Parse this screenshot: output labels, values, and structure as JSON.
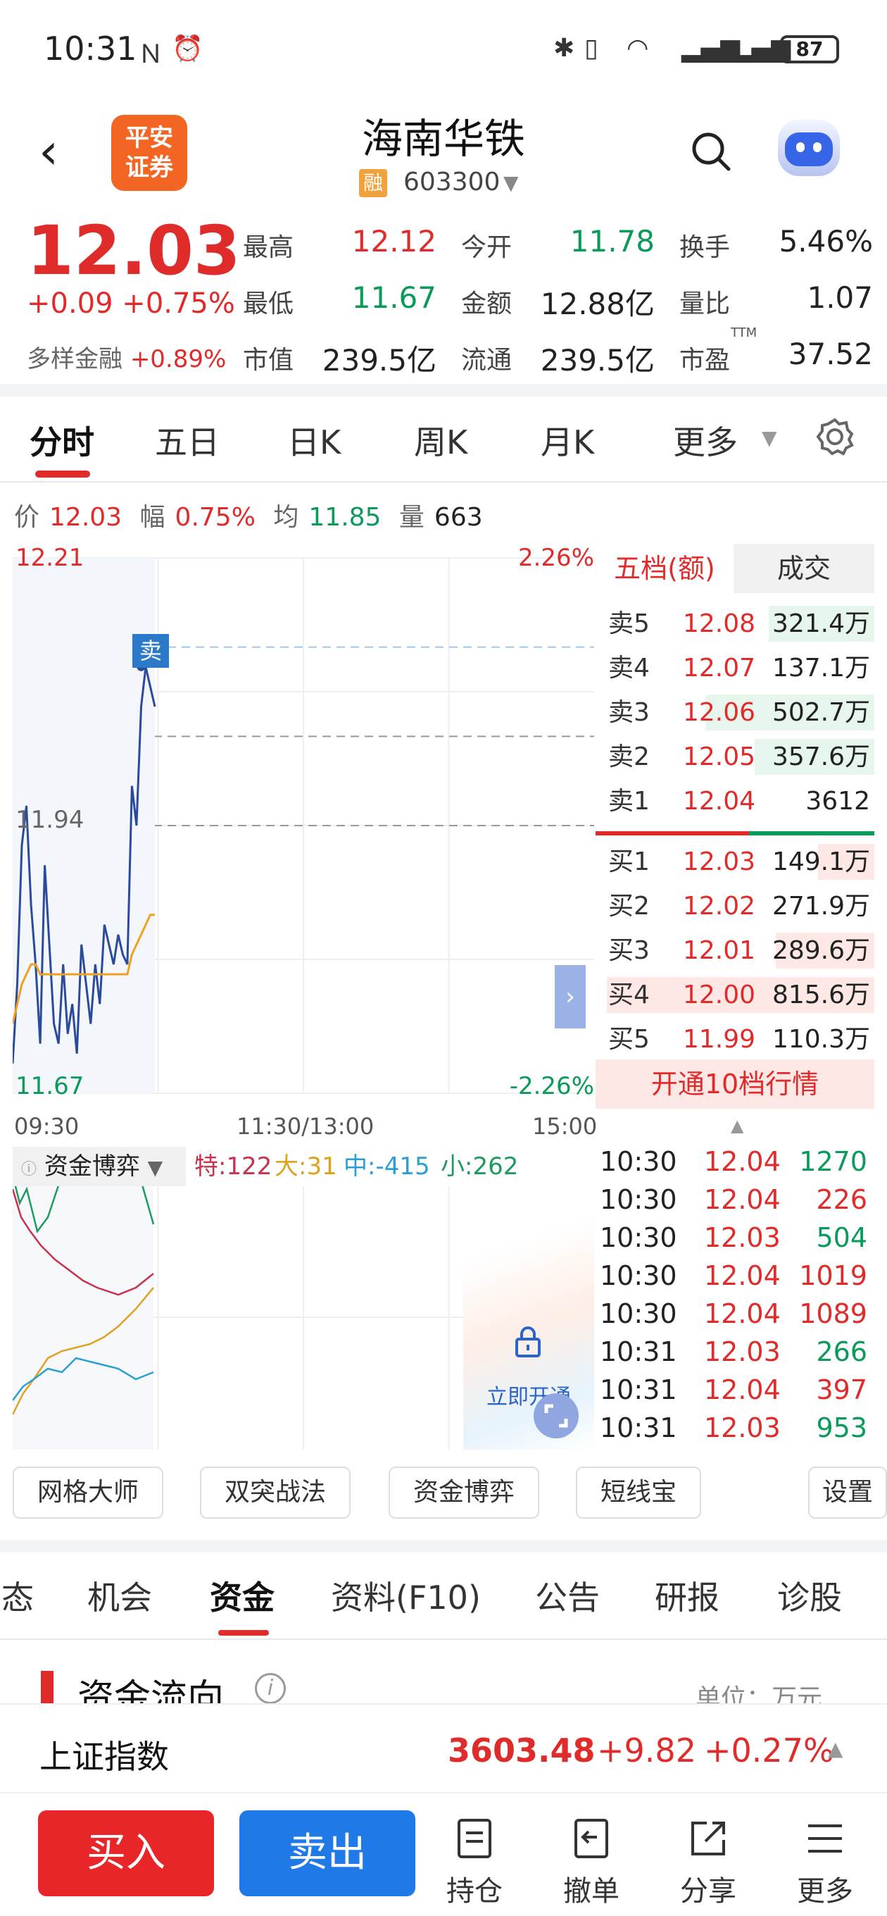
{
  "status_bar": {
    "time": "10:31",
    "battery": "87"
  },
  "header": {
    "logo_text_1": "平安",
    "logo_text_2": "证券",
    "stock_name": "海南华铁",
    "rong_tag": "融",
    "stock_code": "603300"
  },
  "quote": {
    "price": "12.03",
    "change": "+0.09",
    "change_pct": "+0.75%",
    "sector_label": "多样金融",
    "sector_pct": "+0.89%",
    "high_label": "最高",
    "high": "12.12",
    "open_label": "今开",
    "open": "11.78",
    "turnover_label": "换手",
    "turnover": "5.46%",
    "low_label": "最低",
    "low": "11.67",
    "amount_label": "金额",
    "amount": "12.88亿",
    "vol_ratio_label": "量比",
    "vol_ratio": "1.07",
    "mcap_label": "市值",
    "mcap": "239.5亿",
    "float_label": "流通",
    "float": "239.5亿",
    "pe_label": "市盈",
    "pe_sup": "TTM",
    "pe": "37.52"
  },
  "tabs": [
    "分时",
    "五日",
    "日K",
    "周K",
    "月K",
    "更多"
  ],
  "info_line": {
    "price_label": "价",
    "price": "12.03",
    "amp_label": "幅",
    "amp": "0.75%",
    "avg_label": "均",
    "avg": "11.85",
    "vol_label": "量",
    "vol": "663"
  },
  "chart_labels": {
    "top_price": "12.21",
    "top_pct": "2.26%",
    "mid_price": "11.94",
    "bottom_price": "11.67",
    "bottom_pct": "-2.26%",
    "sell_marker": "卖",
    "t_start": "09:30",
    "t_mid": "11:30/13:00",
    "t_end": "15:00"
  },
  "chart_data": {
    "type": "line",
    "x_range": [
      "09:30",
      "15:00"
    ],
    "ylim": [
      11.67,
      12.21
    ],
    "series": [
      {
        "values": [
          11.7,
          11.78,
          11.92,
          11.96,
          11.86,
          11.8,
          11.72,
          11.9,
          11.82,
          11.74,
          11.72,
          11.8,
          11.73,
          11.76,
          11.71,
          11.82,
          11.78,
          11.74,
          11.8,
          11.76,
          11.84,
          11.82,
          11.8,
          11.83,
          11.81,
          11.8,
          11.98,
          11.94,
          12.06,
          12.1,
          12.08,
          12.06
        ]
      },
      {
        "values": [
          11.74,
          11.76,
          11.78,
          11.79,
          11.8,
          11.8,
          11.79,
          11.79,
          11.79,
          11.79,
          11.79,
          11.79,
          11.79,
          11.79,
          11.79,
          11.79,
          11.79,
          11.79,
          11.79,
          11.79,
          11.79,
          11.79,
          11.79,
          11.79,
          11.79,
          11.79,
          11.81,
          11.82,
          11.83,
          11.84,
          11.85,
          11.85
        ]
      }
    ]
  },
  "orderbook": {
    "tab1": "五档(额)",
    "tab2": "成交",
    "asks": [
      {
        "label": "卖5",
        "price": "12.08",
        "vol": "321.4万"
      },
      {
        "label": "卖4",
        "price": "12.07",
        "vol": "137.1万"
      },
      {
        "label": "卖3",
        "price": "12.06",
        "vol": "502.7万"
      },
      {
        "label": "卖2",
        "price": "12.05",
        "vol": "357.6万"
      },
      {
        "label": "卖1",
        "price": "12.04",
        "vol": "3612"
      }
    ],
    "bids": [
      {
        "label": "买1",
        "price": "12.03",
        "vol": "149.1万"
      },
      {
        "label": "买2",
        "price": "12.02",
        "vol": "271.9万"
      },
      {
        "label": "买3",
        "price": "12.01",
        "vol": "289.6万"
      },
      {
        "label": "买4",
        "price": "12.00",
        "vol": "815.6万"
      },
      {
        "label": "买5",
        "price": "11.99",
        "vol": "110.3万"
      }
    ],
    "upgrade": "开通10档行情"
  },
  "capital_game": {
    "title": "资金博弈",
    "te": "特:122",
    "da": "大:31",
    "zhong": "中:-415",
    "xiao": "小:262",
    "unlock": "立即开通"
  },
  "trades": [
    {
      "t": "10:30",
      "p": "12.04",
      "v": "1270",
      "c": "green"
    },
    {
      "t": "10:30",
      "p": "12.04",
      "v": "226",
      "c": "red"
    },
    {
      "t": "10:30",
      "p": "12.03",
      "v": "504",
      "c": "green"
    },
    {
      "t": "10:30",
      "p": "12.04",
      "v": "1019",
      "c": "red"
    },
    {
      "t": "10:30",
      "p": "12.04",
      "v": "1089",
      "c": "red"
    },
    {
      "t": "10:31",
      "p": "12.03",
      "v": "266",
      "c": "green"
    },
    {
      "t": "10:31",
      "p": "12.04",
      "v": "397",
      "c": "red"
    },
    {
      "t": "10:31",
      "p": "12.03",
      "v": "953",
      "c": "green"
    }
  ],
  "tools": [
    "网格大师",
    "双突战法",
    "资金博弈",
    "短线宝",
    "设置"
  ],
  "section_tabs": [
    "态",
    "机会",
    "资金",
    "资料(F10)",
    "公告",
    "研报",
    "诊股"
  ],
  "flow": {
    "title": "资金流向",
    "unit": "单位：万元",
    "info": "i"
  },
  "index": {
    "name": "上证指数",
    "value": "3603.48",
    "change": "+9.82",
    "pct": "+0.27%"
  },
  "bottom": {
    "buy": "买入",
    "sell": "卖出",
    "hold": "持仓",
    "cancel": "撤单",
    "share": "分享",
    "more": "更多"
  }
}
